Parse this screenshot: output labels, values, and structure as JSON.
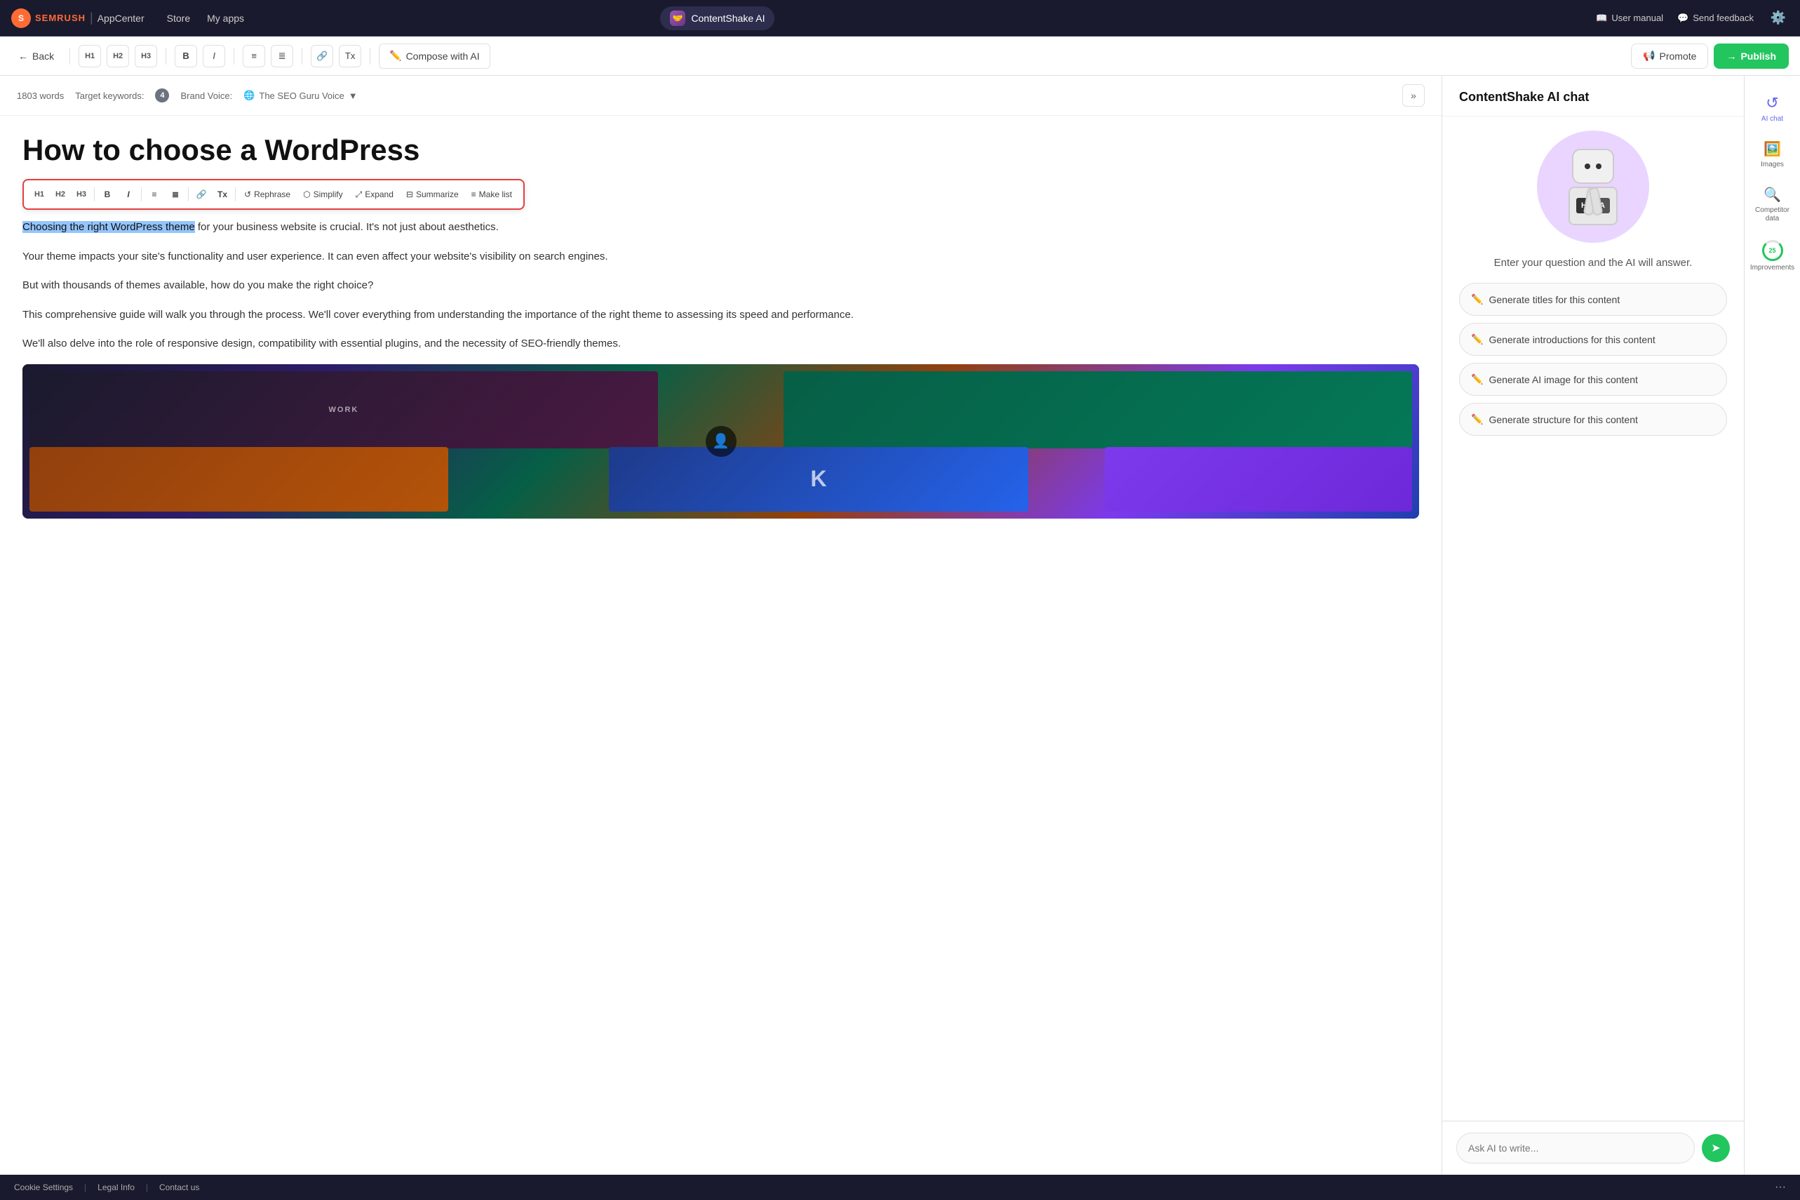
{
  "nav": {
    "brand": "SEMRUSH",
    "app_center": "AppCenter",
    "store": "Store",
    "my_apps": "My apps",
    "app_name": "ContentShake AI",
    "user_manual": "User manual",
    "send_feedback": "Send feedback"
  },
  "toolbar": {
    "back": "Back",
    "h1": "H1",
    "h2": "H2",
    "h3": "H3",
    "bold": "B",
    "italic": "I",
    "compose_ai": "Compose with AI",
    "promote": "Promote",
    "publish": "Publish"
  },
  "editor_meta": {
    "word_count": "1803 words",
    "target_keywords_label": "Target keywords:",
    "keywords_count": "4",
    "brand_voice_label": "Brand Voice:",
    "brand_voice_value": "The SEO Guru Voice"
  },
  "article": {
    "title": "How to choose a WordPress",
    "selected_text": "Choosing the right WordPress theme",
    "selected_rest": " for your business website is crucial. It's not just about aesthetics.",
    "para1": "Your theme impacts your site's functionality and user experience. It can even affect your website's visibility on search engines.",
    "para2": "But with thousands of themes available, how do you make the right choice?",
    "para3": "This comprehensive guide will walk you through the process. We'll cover everything from understanding the importance of the right theme to assessing its speed and performance.",
    "para4": "We'll also delve into the role of responsive design, compatibility with essential plugins, and the necessity of SEO-friendly themes."
  },
  "floating_toolbar": {
    "h1": "H1",
    "h2": "H2",
    "h3": "H3",
    "bold": "B",
    "italic": "I",
    "rephrase": "Rephrase",
    "simplify": "Simplify",
    "expand": "Expand",
    "summarize": "Summarize",
    "make_list": "Make list"
  },
  "ai_panel": {
    "title": "ContentShake AI chat",
    "question_text": "Enter your question and the AI will answer.",
    "suggestions": [
      "Generate titles for this content",
      "Generate introductions for this content",
      "Generate AI image for this content",
      "Generate structure for this content"
    ],
    "input_placeholder": "Ask AI to write...",
    "send_label": "→"
  },
  "right_sidebar": {
    "items": [
      {
        "id": "ai-chat",
        "label": "AI chat",
        "symbol": "↺",
        "active": true
      },
      {
        "id": "images",
        "label": "Images",
        "symbol": "🖼"
      },
      {
        "id": "competitor-data",
        "label": "Competitor data",
        "symbol": "🔍"
      },
      {
        "id": "improvements",
        "label": "Improvements",
        "count": "25"
      }
    ]
  },
  "footer": {
    "cookie_settings": "Cookie Settings",
    "legal_info": "Legal Info",
    "contact_us": "Contact us"
  }
}
